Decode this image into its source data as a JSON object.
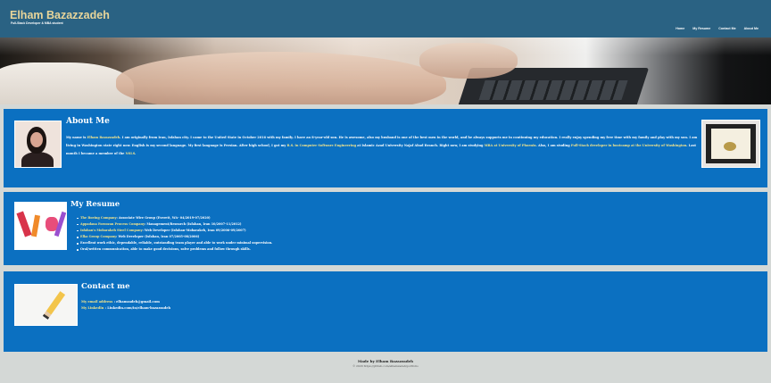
{
  "header": {
    "title": "Elham Bazazzadeh",
    "subtitle": "Full-Stack Developer & MBA student",
    "nav": [
      "Home",
      "My Resume",
      "Contact Me",
      "About Me"
    ]
  },
  "about": {
    "title": "About Me",
    "intro": "My name is ",
    "name_hl": "Elham Bazazzadeh",
    "p1": ". I am originally from Iran, Isfahan city. I came to the United State in October 2016 with my family. I have an 8-year-old son. He is awesome, also my husband is one of the best men in the world, and he always supports me in continuing my education. I really enjoy spending my free time with my family and play with my son. I am living in Washington state right now. English is my second language. My first language is Persian. After high school, I got my ",
    "degree_hl": "B.S. in Computer Software Engineering",
    "p2": " at Islamic Azad University Najaf Abad Branch. Right now, I am studying ",
    "mba_hl": "MBA at University of Phoenix",
    "p3": ". Also, I am studing ",
    "bootcamp_hl": "Full-Stack developer in bootcamp at the University of Washington",
    "p4": ". Last month I became a member of the ",
    "nsls_hl": "NSLS",
    "p5": "."
  },
  "resume": {
    "title": "My Resume",
    "items": [
      {
        "company": "The Boeing Company",
        "role": ": Associate Wire Group (Everett, WA- 04/2019-07/2020)"
      },
      {
        "company": "Appadana Foroozan Process Company",
        "role": ": Management/Research (Isfahan, Iran 10/2007-11/2012)"
      },
      {
        "company": "Isfahan's Mobarakeh Steel Company",
        "role": ": Web Developer (Isfahan-Mobarakeh, Iran 09/2006-09/2007)"
      },
      {
        "company": "Elka Group Company",
        "role": ": Web Developer (Isfahan, Iran 07/2005-08/2006)"
      },
      {
        "company": "",
        "role": "Excellent work ethic, dependable, reliable, outstanding team player and able to work under minimal supervision."
      },
      {
        "company": "",
        "role": "Oral/written communication, able to make good decisions, solve problems and follow through skills."
      }
    ]
  },
  "contact": {
    "title": "Contact me",
    "email_label": "My email address",
    "email_value": " : elhamzadeh@gmail.com",
    "linkedin_label": "My LinkedIn",
    "linkedin_value": " : Linkedin.com/in/elham-bazazzadeh"
  },
  "footer": {
    "made_by": "Made by Elham Bazazzadeh",
    "copyright": "© 2020 https://github.com/elhamzadeh/portfolio"
  }
}
